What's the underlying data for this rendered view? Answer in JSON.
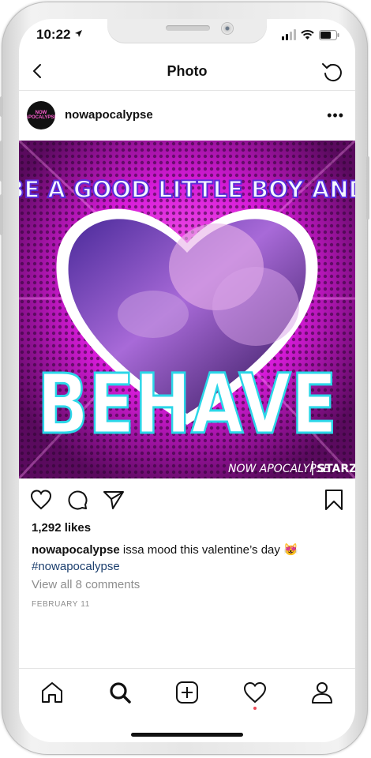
{
  "status_bar": {
    "time": "10:22"
  },
  "header": {
    "title": "Photo"
  },
  "post": {
    "username": "nowapocalypse",
    "avatar_text": "NOW APOCALYPSE",
    "image_text": {
      "top_line": "BE A GOOD LITTLE BOY AND",
      "big_word": "BEHAVE",
      "brand": "NOW APOCALYPSE",
      "network": "STARZ"
    },
    "likes": "1,292 likes",
    "caption_user": "nowapocalypse",
    "caption_text": "issa mood this valentine’s day 😻",
    "hashtag": "#nowapocalypse",
    "comments_link": "View all 8 comments",
    "date": "FEBRUARY 11"
  },
  "icons": {
    "back": "chevron-left-icon",
    "refresh": "refresh-icon",
    "more": "more-icon",
    "actions": [
      "heart-icon",
      "comment-icon",
      "share-icon",
      "bookmark-icon"
    ],
    "tabs": [
      "home-icon",
      "search-icon",
      "add-icon",
      "activity-icon",
      "profile-icon"
    ]
  },
  "colors": {
    "accent_pink": "#d61bd8",
    "hashtag": "#1c3f6e",
    "notification_dot": "#ed4956"
  }
}
